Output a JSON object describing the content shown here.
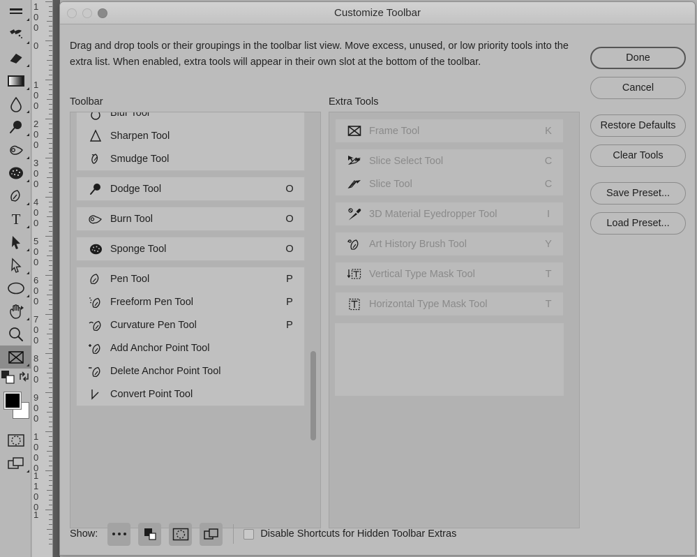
{
  "window": {
    "title": "Customize Toolbar",
    "traffic_lights": [
      "close-button",
      "minimize-button",
      "zoom-button"
    ]
  },
  "intro_text": "Drag and drop tools or their groupings in the toolbar list view. Move excess, unused, or low priority tools into the extra list. When enabled, extra tools will appear in their own slot at the bottom of the toolbar.",
  "columns": {
    "toolbar_title": "Toolbar",
    "extra_title": "Extra Tools"
  },
  "toolbar_groups": [
    {
      "tools": [
        {
          "icon": "blur-tool-icon",
          "label": "Blur Tool",
          "key": ""
        },
        {
          "icon": "sharpen-tool-icon",
          "label": "Sharpen Tool",
          "key": ""
        },
        {
          "icon": "smudge-tool-icon",
          "label": "Smudge Tool",
          "key": ""
        }
      ]
    },
    {
      "tools": [
        {
          "icon": "dodge-tool-icon",
          "label": "Dodge Tool",
          "key": "O"
        }
      ]
    },
    {
      "tools": [
        {
          "icon": "burn-tool-icon",
          "label": "Burn Tool",
          "key": "O"
        }
      ]
    },
    {
      "tools": [
        {
          "icon": "sponge-tool-icon",
          "label": "Sponge Tool",
          "key": "O"
        }
      ]
    },
    {
      "tools": [
        {
          "icon": "pen-tool-icon",
          "label": "Pen Tool",
          "key": "P"
        },
        {
          "icon": "freeform-pen-tool-icon",
          "label": "Freeform Pen Tool",
          "key": "P"
        },
        {
          "icon": "curvature-pen-tool-icon",
          "label": "Curvature Pen Tool",
          "key": "P"
        },
        {
          "icon": "add-anchor-point-tool-icon",
          "label": "Add Anchor Point Tool",
          "key": ""
        },
        {
          "icon": "delete-anchor-point-tool-icon",
          "label": "Delete Anchor Point Tool",
          "key": ""
        },
        {
          "icon": "convert-point-tool-icon",
          "label": "Convert Point Tool",
          "key": ""
        }
      ]
    }
  ],
  "extra_groups": [
    {
      "tools": [
        {
          "icon": "frame-tool-icon",
          "label": "Frame Tool",
          "key": "K"
        }
      ]
    },
    {
      "tools": [
        {
          "icon": "slice-select-tool-icon",
          "label": "Slice Select Tool",
          "key": "C"
        },
        {
          "icon": "slice-tool-icon",
          "label": "Slice Tool",
          "key": "C"
        }
      ]
    },
    {
      "tools": [
        {
          "icon": "3d-material-eyedropper-tool-icon",
          "label": "3D Material Eyedropper Tool",
          "key": "I"
        }
      ]
    },
    {
      "tools": [
        {
          "icon": "art-history-brush-tool-icon",
          "label": "Art History Brush Tool",
          "key": "Y"
        }
      ]
    },
    {
      "tools": [
        {
          "icon": "vertical-type-mask-tool-icon",
          "label": "Vertical Type Mask Tool",
          "key": "T"
        }
      ]
    },
    {
      "tools": [
        {
          "icon": "horizontal-type-mask-tool-icon",
          "label": "Horizontal Type Mask Tool",
          "key": "T"
        }
      ]
    }
  ],
  "buttons": {
    "done": "Done",
    "cancel": "Cancel",
    "restore_defaults": "Restore Defaults",
    "clear_tools": "Clear Tools",
    "save_preset": "Save Preset...",
    "load_preset": "Load Preset..."
  },
  "bottom_bar": {
    "show_label": "Show:",
    "icon_buttons": [
      "extra-tools-icon",
      "edit-toolbar-icon",
      "quick-mask-icon",
      "screen-mode-icon"
    ],
    "checkbox": {
      "label": "Disable Shortcuts for Hidden Toolbar Extras",
      "checked": false
    }
  },
  "app_toolbar": {
    "tools": [
      "gradient-strip-icon",
      "mixer-brush-tool-icon",
      "eraser-tool-icon",
      "gradient-tool-icon",
      "blur-tool-icon",
      "dodge-tool-icon",
      "burn-tool-icon",
      "sponge-tool-icon",
      "pen-tool-icon",
      "type-tool-icon",
      "path-selection-tool-icon",
      "direct-selection-tool-icon",
      "ellipse-tool-icon",
      "hand-tool-icon",
      "zoom-tool-icon",
      "edit-toolbar-icon"
    ],
    "selected_tool": "edit-toolbar-icon",
    "foreground_color": "#000000",
    "background_color": "#ffffff"
  },
  "ruler": {
    "unit": "px",
    "labels": [
      "-100",
      "0",
      "100",
      "200",
      "300",
      "400",
      "500",
      "600",
      "700",
      "800",
      "900",
      "1000",
      "1100",
      "1"
    ]
  },
  "colors": {
    "dialog_bg": "#bcbcbc",
    "panel_bg": "#b2b2b2",
    "group_bg": "#c0c0c0",
    "text": "#1e1e1e",
    "dim_text": "#8a8a8a",
    "app_bg": "#b8b8b8"
  }
}
